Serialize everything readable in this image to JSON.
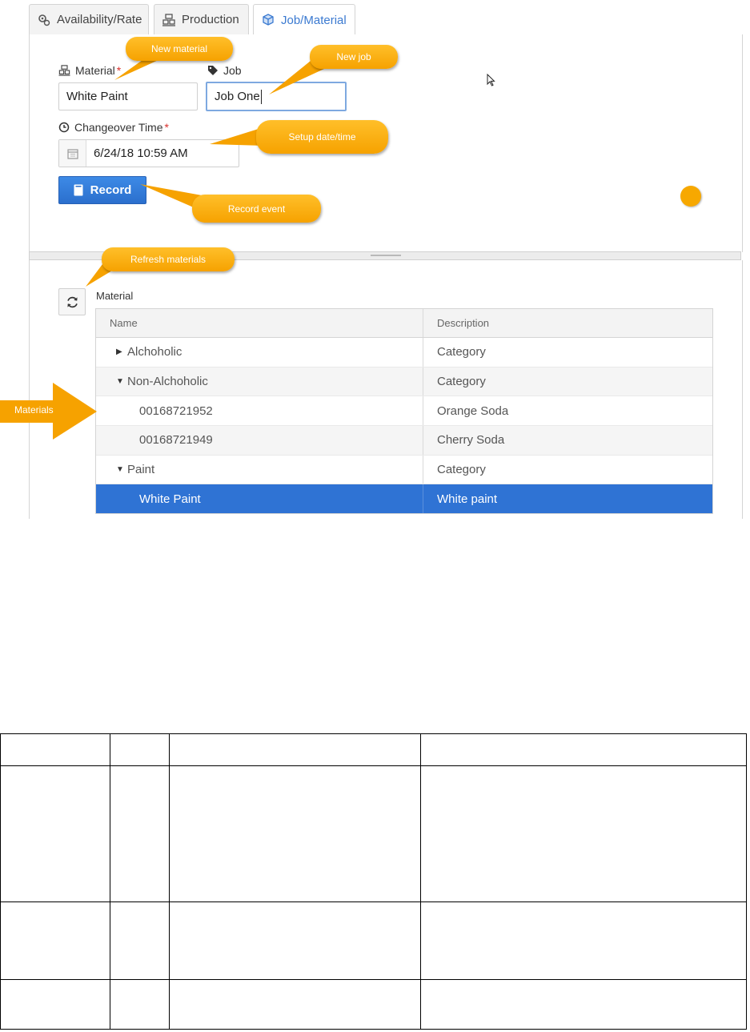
{
  "tabs": [
    {
      "label": "Availability/Rate",
      "icon": "gears-icon"
    },
    {
      "label": "Production",
      "icon": "production-line-icon"
    },
    {
      "label": "Job/Material",
      "icon": "cube-icon",
      "active": true
    }
  ],
  "form": {
    "material_label": "Material",
    "material_required": "*",
    "material_value": "White Paint",
    "job_label": "Job",
    "job_value": "Job One",
    "changeover_label": "Changeover Time",
    "changeover_required": "*",
    "changeover_value": "6/24/18 10:59 AM",
    "record_label": "Record"
  },
  "callouts": {
    "new_material": "New material",
    "new_job": "New job",
    "setup": "Setup date/time",
    "record": "Record event",
    "refresh": "Refresh materials",
    "materials": "Materials"
  },
  "material_section_label": "Material",
  "grid": {
    "headers": [
      "Name",
      "Description"
    ],
    "rows": [
      {
        "name": "Alchoholic",
        "desc": "Category",
        "level": 0,
        "expander": "collapsed"
      },
      {
        "name": "Non-Alchoholic",
        "desc": "Category",
        "level": 0,
        "expander": "expanded"
      },
      {
        "name": "00168721952",
        "desc": "Orange Soda",
        "level": 1
      },
      {
        "name": "00168721949",
        "desc": "Cherry Soda",
        "level": 1
      },
      {
        "name": "Paint",
        "desc": "Category",
        "level": 0,
        "expander": "expanded"
      },
      {
        "name": "White Paint",
        "desc": "White paint",
        "level": 1,
        "selected": true
      }
    ]
  },
  "colors": {
    "accent": "#2f73d4",
    "callout": "#f6a200",
    "required": "#d9302c"
  }
}
